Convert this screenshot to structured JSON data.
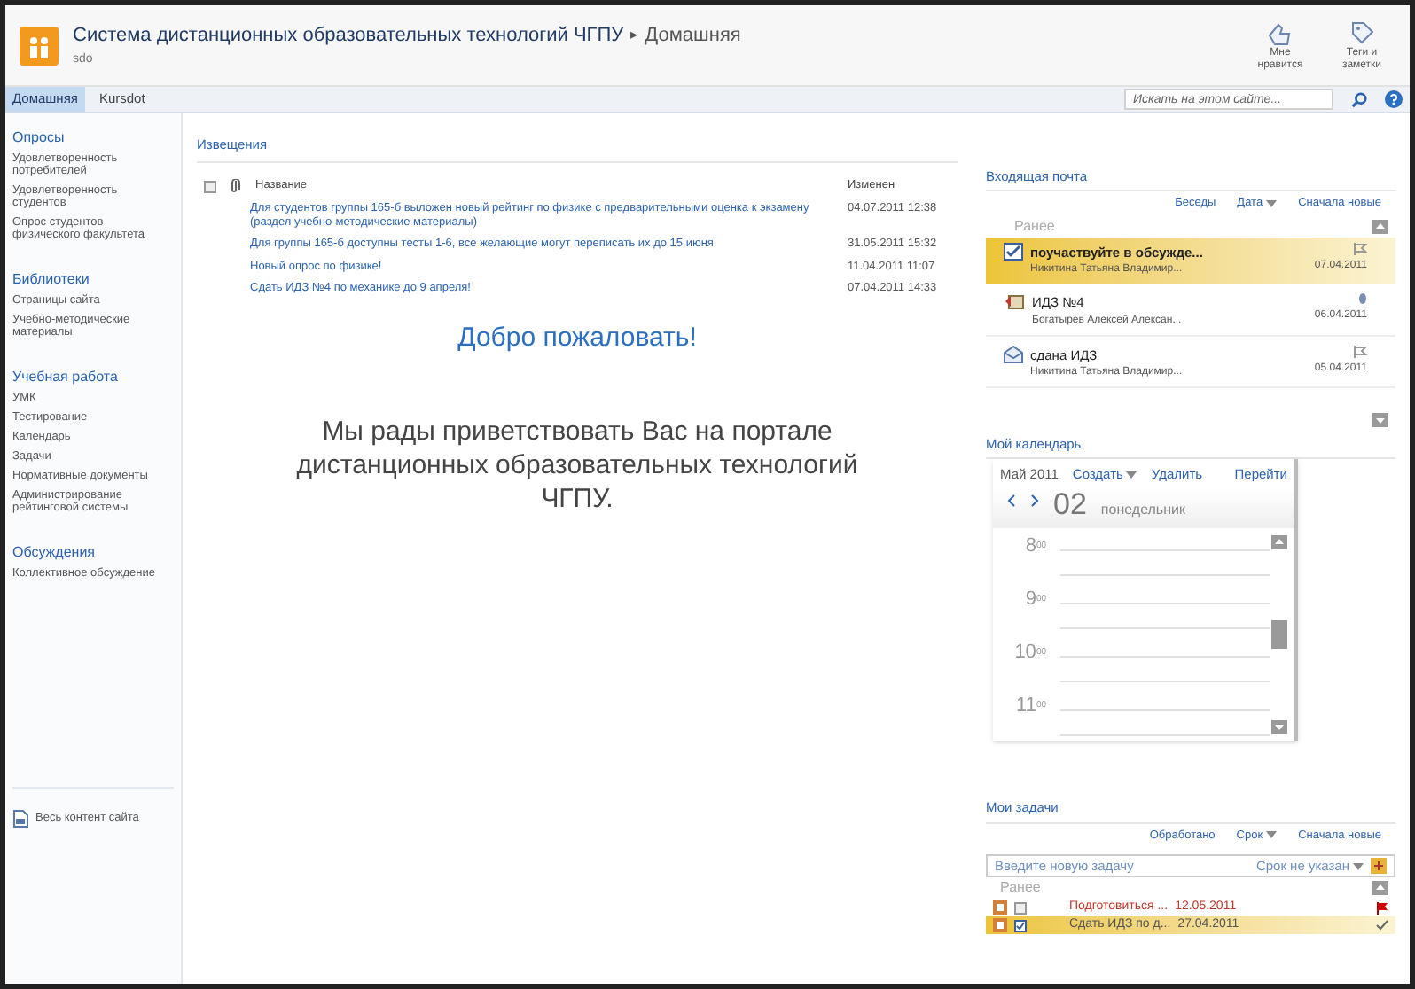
{
  "site": {
    "title": "Система дистанционных образовательных технологий ЧГПУ",
    "separator": "▸",
    "page": "Домашняя",
    "subtitle": "sdo"
  },
  "header_actions": [
    {
      "kind": "like",
      "label": "Мне нравится"
    },
    {
      "kind": "tags",
      "label": "Теги и заметки"
    }
  ],
  "tabs": [
    {
      "label": "Домашняя",
      "selected": true
    },
    {
      "label": "Kursdot",
      "selected": false
    }
  ],
  "search": {
    "placeholder": "Искать на этом сайте..."
  },
  "sidebar": {
    "sections": [
      {
        "heading": "Опросы",
        "items": [
          "Удовлетворенность потребителей",
          "Удовлетворенность студентов",
          "Опрос студентов физического факультета"
        ]
      },
      {
        "heading": "Библиотеки",
        "items": [
          "Страницы сайта",
          "Учебно-методические материалы"
        ]
      },
      {
        "heading": "Учебная работа",
        "items": [
          "УМК",
          "Тестирование",
          "Календарь",
          "Задачи",
          "Нормативные документы",
          "Администрирование рейтинговой системы"
        ]
      },
      {
        "heading": "Обсуждения",
        "items": [
          "Коллективное обсуждение"
        ]
      }
    ],
    "footer": "Весь контент сайта"
  },
  "announcements": {
    "title": "Извещения",
    "select_all_checked": false,
    "columns": [
      "Название",
      "Изменен"
    ],
    "rows": [
      {
        "title": "Для студентов группы 165-б выложен новый рейтинг по физике с предварительными оценка к экзамену (раздел учебно-методические материалы)",
        "modified": "04.07.2011 12:38"
      },
      {
        "title": "Для группы 165-б доступны тесты 1-6, все желающие могут переписать их до 15 июня",
        "modified": "31.05.2011 15:32"
      },
      {
        "title": "Новый опрос по физике!",
        "modified": "11.04.2011 11:07"
      },
      {
        "title": "Сдать ИДЗ №4 по механике до 9 апреля!",
        "modified": "07.04.2011 14:33"
      }
    ]
  },
  "welcome": {
    "heading": "Добро пожаловать!",
    "message": "Мы рады приветствовать Вас на портале дистанционных образовательных технологий ЧГПУ."
  },
  "inbox": {
    "title": "Входящая почта",
    "controls": [
      {
        "label": "Беседы",
        "dropdown": false
      },
      {
        "label": "Дата",
        "dropdown": true
      },
      {
        "label": "Сначала новые",
        "dropdown": false
      }
    ],
    "group": "Ранее",
    "messages": [
      {
        "kind": "unread",
        "subject": "поучаствуйте в обсужде...",
        "sender": "Никитина Татьяна Владимир...",
        "date": "07.04.2011",
        "selected": true,
        "attachment": false
      },
      {
        "kind": "replied",
        "subject": "ИДЗ №4",
        "sender": "Богатырев Алексей Алексан...",
        "date": "06.04.2011",
        "selected": false,
        "attachment": true
      },
      {
        "kind": "read",
        "subject": "сдана ИДЗ",
        "sender": "Никитина Татьяна Владимир...",
        "date": "05.04.2011",
        "selected": false,
        "attachment": false
      }
    ]
  },
  "calendar": {
    "title": "Мой календарь",
    "month": "Май 2011",
    "actions": [
      {
        "label": "Создать",
        "dropdown": true
      },
      {
        "label": "Удалить",
        "dropdown": false
      },
      {
        "label": "Перейти",
        "dropdown": false
      }
    ],
    "day": "02",
    "weekday": "понедельник",
    "hours": [
      {
        "hour": "8",
        "minutes": "00"
      },
      {
        "hour": "9",
        "minutes": "00"
      },
      {
        "hour": "10",
        "minutes": "00"
      },
      {
        "hour": "11",
        "minutes": "00"
      }
    ]
  },
  "tasks": {
    "title": "Мои задачи",
    "controls": [
      {
        "label": "Обработано",
        "dropdown": false
      },
      {
        "label": "Срок",
        "dropdown": true
      },
      {
        "label": "Сначала новые",
        "dropdown": false
      }
    ],
    "new_task": {
      "placeholder": "Введите новую задачу",
      "due_placeholder": "Срок не указан"
    },
    "group": "Ранее",
    "items": [
      {
        "text": "Подготовиться ...",
        "due": "12.05.2011",
        "checked": false,
        "overdue": true,
        "selected": false
      },
      {
        "text": "Сдать ИДЗ по д...",
        "due": "27.04.2011",
        "checked": true,
        "overdue": false,
        "selected": true
      }
    ]
  }
}
